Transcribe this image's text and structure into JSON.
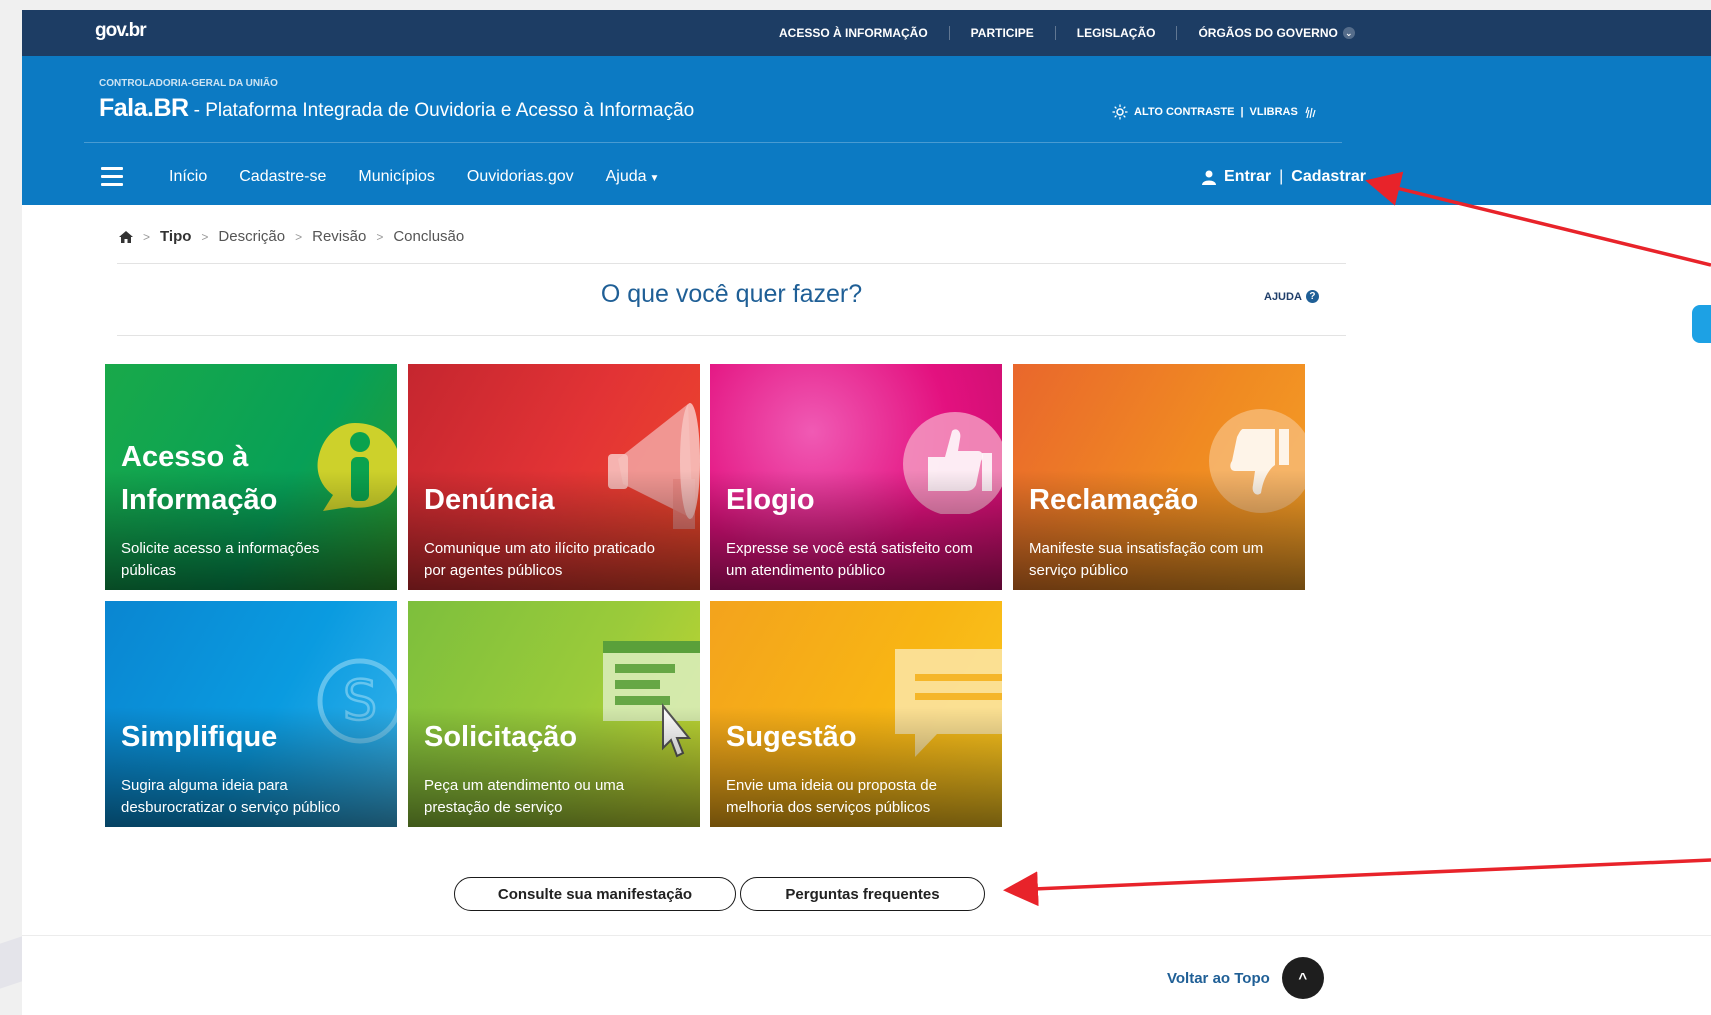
{
  "govbar": {
    "logo": "gov.br",
    "links": [
      "ACESSO À INFORMAÇÃO",
      "PARTICIPE",
      "LEGISLAÇÃO",
      "ÓRGÃOS DO GOVERNO"
    ]
  },
  "header": {
    "org": "CONTROLADORIA-GERAL DA UNIÃO",
    "brand_name": "Fala.BR",
    "brand_sub": "- Plataforma Integrada de Ouvidoria e Acesso à Informação",
    "alto_contraste": "ALTO CONTRASTE",
    "vlibras": "VLIBRAS",
    "nav": [
      "Início",
      "Cadastre-se",
      "Municípios",
      "Ouvidorias.gov",
      "Ajuda"
    ],
    "entrar": "Entrar",
    "cadastrar": "Cadastrar"
  },
  "breadcrumb": [
    "Tipo",
    "Descrição",
    "Revisão",
    "Conclusão"
  ],
  "question": "O que você quer fazer?",
  "help": "AJUDA",
  "tiles": [
    {
      "title_line1": "Acesso à",
      "title_line2": "Informação",
      "desc_line1": "Solicite acesso a informações",
      "desc_line2": "públicas",
      "color": "#0aa24e"
    },
    {
      "title_line1": "",
      "title_line2": "Denúncia",
      "desc_line1": "Comunique um ato ilícito praticado",
      "desc_line2": "por agentes públicos",
      "color": "#e0262f"
    },
    {
      "title_line1": "",
      "title_line2": "Elogio",
      "desc_line1": "Expresse se você está satisfeito com",
      "desc_line2": "um atendimento público",
      "color": "#e3117f"
    },
    {
      "title_line1": "",
      "title_line2": "Reclamação",
      "desc_line1": "Manifeste sua insatisfação com um",
      "desc_line2": "serviço público",
      "color": "#ef7c1f"
    },
    {
      "title_line1": "",
      "title_line2": "Simplifique",
      "desc_line1": "Sugira alguma ideia para",
      "desc_line2": "desburocratizar o serviço público",
      "color": "#0a8fd6"
    },
    {
      "title_line1": "",
      "title_line2": "Solicitação",
      "desc_line1": "Peça um atendimento ou uma",
      "desc_line2": "prestação de serviço",
      "color": "#8cc63f"
    },
    {
      "title_line1": "",
      "title_line2": "Sugestão",
      "desc_line1": "Envie uma ideia ou proposta de",
      "desc_line2": "melhoria dos serviços públicos",
      "color": "#f8b514"
    }
  ],
  "buttons": {
    "consulte": "Consulte sua manifestação",
    "perguntas": "Perguntas frequentes"
  },
  "footer": {
    "back_to_top": "Voltar ao Topo"
  },
  "colors": {
    "govbar": "#1d3d64",
    "header": "#0c7ac3",
    "annotation_arrow": "#e8232a"
  }
}
